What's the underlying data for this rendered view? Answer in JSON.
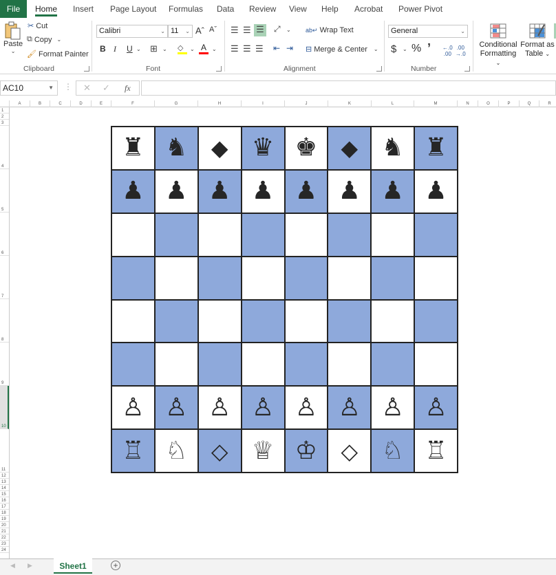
{
  "tabs": {
    "file": "File",
    "items": [
      "Home",
      "Insert",
      "Page Layout",
      "Formulas",
      "Data",
      "Review",
      "View",
      "Help",
      "Acrobat",
      "Power Pivot"
    ],
    "active": "Home"
  },
  "ribbon": {
    "clipboard": {
      "label": "Clipboard",
      "paste": "Paste",
      "cut": "Cut",
      "copy": "Copy",
      "format_painter": "Format Painter"
    },
    "font": {
      "label": "Font",
      "font_name": "Calibri",
      "font_size": "11",
      "bold": "B",
      "italic": "I",
      "underline": "U",
      "grow": "Aˆ",
      "shrink": "Aˇ",
      "font_color_letter": "A",
      "fill_color": "#ffff00",
      "font_color": "#ff0000"
    },
    "alignment": {
      "label": "Alignment",
      "wrap_text": "Wrap Text",
      "merge_center": "Merge & Center"
    },
    "number": {
      "label": "Number",
      "format": "General",
      "currency": "$",
      "percent": "%",
      "comma": "’"
    },
    "styles": {
      "conditional_formatting_1": "Conditional",
      "conditional_formatting_2": "Formatting",
      "format_as_table_1": "Format as",
      "format_as_table_2": "Table"
    }
  },
  "formula_bar": {
    "name_box": "AC10",
    "fx": "fx",
    "value": ""
  },
  "columns": [
    "A",
    "B",
    "C",
    "D",
    "E",
    "F",
    "G",
    "H",
    "I",
    "J",
    "K",
    "L",
    "M",
    "N",
    "O",
    "P",
    "Q",
    "R"
  ],
  "rows": [
    "1",
    "2",
    "3",
    "4",
    "5",
    "6",
    "7",
    "8",
    "9",
    "10",
    "11",
    "12",
    "13",
    "14",
    "15",
    "16",
    "17",
    "18",
    "19",
    "20",
    "21",
    "22",
    "23",
    "24"
  ],
  "selected_row": "10",
  "board": {
    "light_color": "#ffffff",
    "dark_color": "#8ea9db",
    "ranks": [
      [
        "♜",
        "♞",
        "◆",
        "♛",
        "♚",
        "◆",
        "♞",
        "♜"
      ],
      [
        "♟",
        "♟",
        "♟",
        "♟",
        "♟",
        "♟",
        "♟",
        "♟"
      ],
      [
        "",
        "",
        "",
        "",
        "",
        "",
        "",
        ""
      ],
      [
        "",
        "",
        "",
        "",
        "",
        "",
        "",
        ""
      ],
      [
        "",
        "",
        "",
        "",
        "",
        "",
        "",
        ""
      ],
      [
        "",
        "",
        "",
        "",
        "",
        "",
        "",
        ""
      ],
      [
        "♙",
        "♙",
        "♙",
        "♙",
        "♙",
        "♙",
        "♙",
        "♙"
      ],
      [
        "♖",
        "♘",
        "◇",
        "♕",
        "♔",
        "◇",
        "♘",
        "♖"
      ]
    ]
  },
  "sheets": {
    "tabs": [
      "Sheet1"
    ],
    "active": "Sheet1",
    "add_icon": "+"
  }
}
